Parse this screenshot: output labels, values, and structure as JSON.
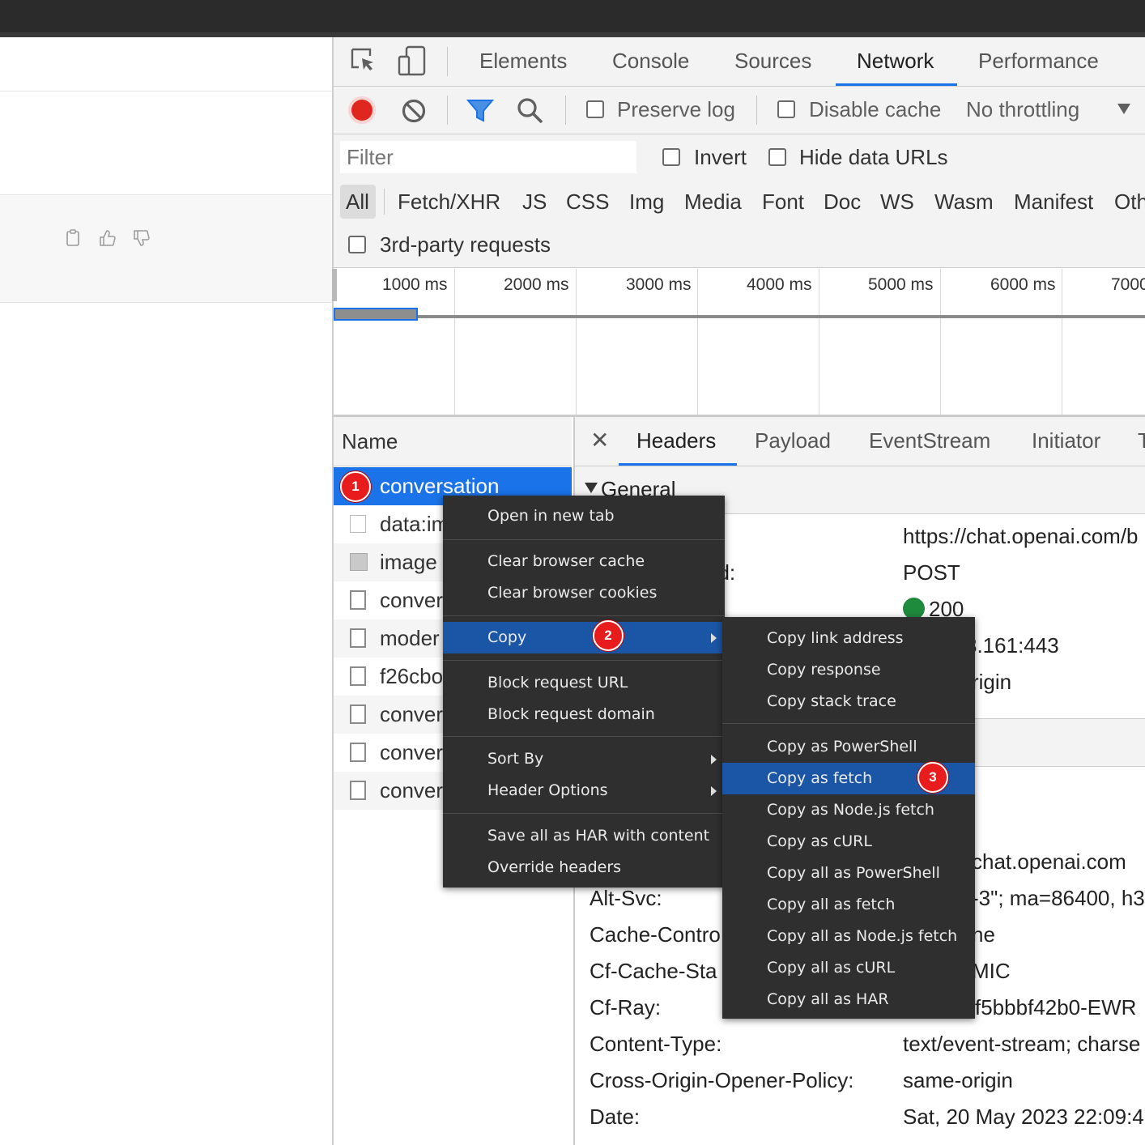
{
  "devtools": {
    "tabs": [
      "Elements",
      "Console",
      "Sources",
      "Network",
      "Performance"
    ],
    "active_tab": "Network",
    "toolbar": {
      "preserve_log": "Preserve log",
      "disable_cache": "Disable cache",
      "throttling": "No throttling"
    },
    "filter": {
      "placeholder": "Filter",
      "invert": "Invert",
      "hide_data_urls": "Hide data URLs",
      "third_party": "3rd-party requests"
    },
    "types": [
      "All",
      "Fetch/XHR",
      "JS",
      "CSS",
      "Img",
      "Media",
      "Font",
      "Doc",
      "WS",
      "Wasm",
      "Manifest",
      "Oth"
    ],
    "timeline_ticks": [
      "1000 ms",
      "2000 ms",
      "3000 ms",
      "4000 ms",
      "5000 ms",
      "6000 ms",
      "7000"
    ],
    "name_header": "Name",
    "requests": [
      "conversation",
      "data:im",
      "image",
      "conver",
      "moder",
      "f26cbo",
      "conver",
      "conver",
      "conver"
    ],
    "detail_tabs": [
      "Headers",
      "Payload",
      "EventStream",
      "Initiator",
      "T"
    ],
    "general_label": "General",
    "general_rows": [
      {
        "key": "",
        "value": "https://chat.openai.com/b"
      },
      {
        "key": "od:",
        "value": "POST"
      },
      {
        "key": "",
        "value": "200"
      },
      {
        "key": "",
        "value": "3.161:443"
      },
      {
        "key": "",
        "value": "rigin"
      }
    ],
    "response_headers": [
      {
        "key": "",
        "value": "chat.openai.com"
      },
      {
        "key": "Alt-Svc:",
        "value": "-3\"; ma=86400, h3"
      },
      {
        "key": "Cache-Contro",
        "value": "ne"
      },
      {
        "key": "Cf-Cache-Sta",
        "value": "MIC"
      },
      {
        "key": "Cf-Ray:",
        "value": "f5bbbf42b0-EWR"
      },
      {
        "key": "Content-Type:",
        "value": "text/event-stream; charse"
      },
      {
        "key": "Cross-Origin-Opener-Policy:",
        "value": "same-origin"
      },
      {
        "key": "Date:",
        "value": "Sat, 20 May 2023 22:09:4"
      }
    ]
  },
  "context_menu": {
    "open_new_tab": "Open in new tab",
    "clear_cache": "Clear browser cache",
    "clear_cookies": "Clear browser cookies",
    "copy": "Copy",
    "block_url": "Block request URL",
    "block_domain": "Block request domain",
    "sort_by": "Sort By",
    "header_options": "Header Options",
    "save_har": "Save all as HAR with content",
    "override_headers": "Override headers"
  },
  "copy_submenu": {
    "link_address": "Copy link address",
    "response": "Copy response",
    "stack_trace": "Copy stack trace",
    "powershell": "Copy as PowerShell",
    "fetch": "Copy as fetch",
    "nodejs_fetch": "Copy as Node.js fetch",
    "curl": "Copy as cURL",
    "all_powershell": "Copy all as PowerShell",
    "all_fetch": "Copy all as fetch",
    "all_nodejs_fetch": "Copy all as Node.js fetch",
    "all_curl": "Copy all as cURL",
    "all_har": "Copy all as HAR"
  },
  "step_badges": [
    "1",
    "2",
    "3"
  ],
  "colors": {
    "accent": "#1a73e8",
    "menu_highlight": "#1b55a6",
    "record": "#e0271f",
    "status_ok": "#1e8a3c",
    "badge": "#e81c1c"
  }
}
